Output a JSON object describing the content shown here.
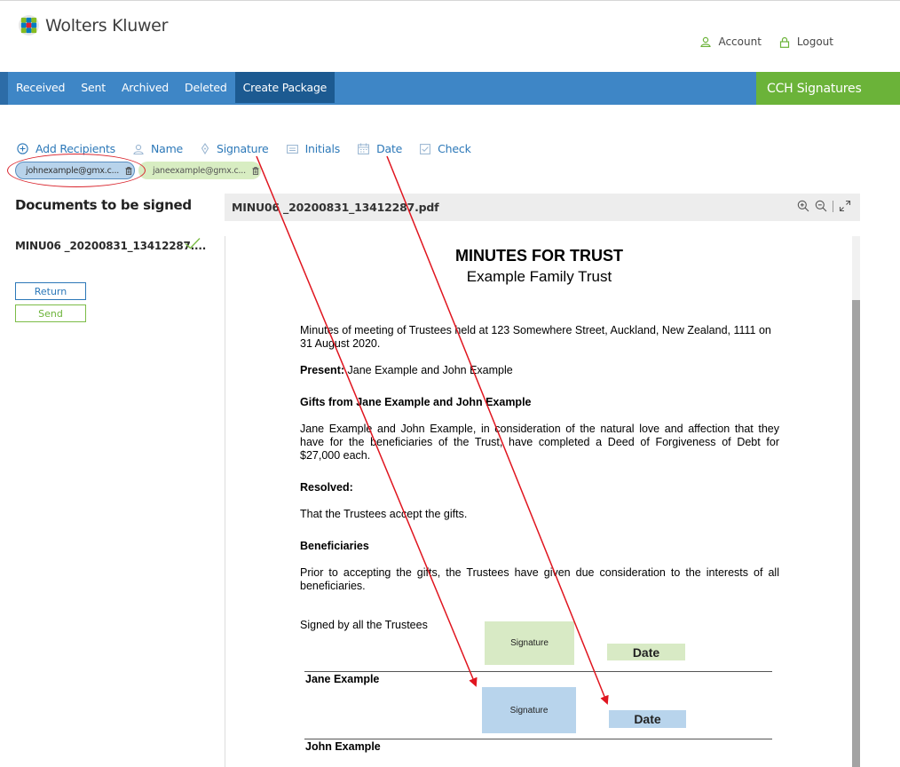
{
  "brand": {
    "logo_text": "Wolters Kluwer",
    "product_name": "CCH Signatures",
    "accent_blue": "#3e86c6",
    "accent_green": "#6bb339"
  },
  "header": {
    "account_label": "Account",
    "logout_label": "Logout"
  },
  "nav": {
    "tabs": [
      {
        "label": "Received"
      },
      {
        "label": "Sent"
      },
      {
        "label": "Archived"
      },
      {
        "label": "Deleted"
      },
      {
        "label": "Create Package",
        "active": true
      }
    ]
  },
  "tools": {
    "add_recipients": "Add Recipients",
    "name": "Name",
    "signature": "Signature",
    "initials": "Initials",
    "date": "Date",
    "check": "Check"
  },
  "recipients": [
    {
      "email": "johnexample@gmx.c...",
      "selected": true
    },
    {
      "email": "janeexample@gmx.c...",
      "selected": false
    }
  ],
  "left_panel": {
    "title": "Documents to be signed",
    "documents": [
      {
        "name": "MINU06 _20200831_13412287....",
        "status_icon": "check-icon"
      }
    ],
    "return_label": "Return",
    "send_label": "Send"
  },
  "viewer": {
    "filename": "MINU06 _20200831_13412287.pdf",
    "tools": [
      "zoom-in-icon",
      "zoom-out-icon",
      "fullscreen-icon"
    ]
  },
  "document": {
    "title": "MINUTES FOR TRUST",
    "subtitle": "Example Family Trust",
    "intro": "Minutes of meeting of Trustees held at 123 Somewhere Street, Auckland, New Zealand, 1111 on 31 August 2020.",
    "present_label": "Present:",
    "present_text": " Jane Example and John Example",
    "gifts_heading": "Gifts from Jane Example and John Example",
    "gifts_text": "Jane Example and John Example, in consideration of the natural love and affection that they have for the beneficiaries of the Trust, have completed a Deed of Forgiveness of Debt for $27,000 each.",
    "resolved_heading": "Resolved:",
    "resolved_text": "That the Trustees accept the gifts.",
    "beneficiaries_heading": "Beneficiaries",
    "beneficiaries_text": "Prior to accepting the gifts, the Trustees have given due consideration to the interests of all beneficiaries.",
    "signed_text": "Signed by all the Trustees",
    "signer_1": "Jane Example",
    "signer_2": "John Example",
    "signature_label": "Signature",
    "date_label": "Date"
  }
}
